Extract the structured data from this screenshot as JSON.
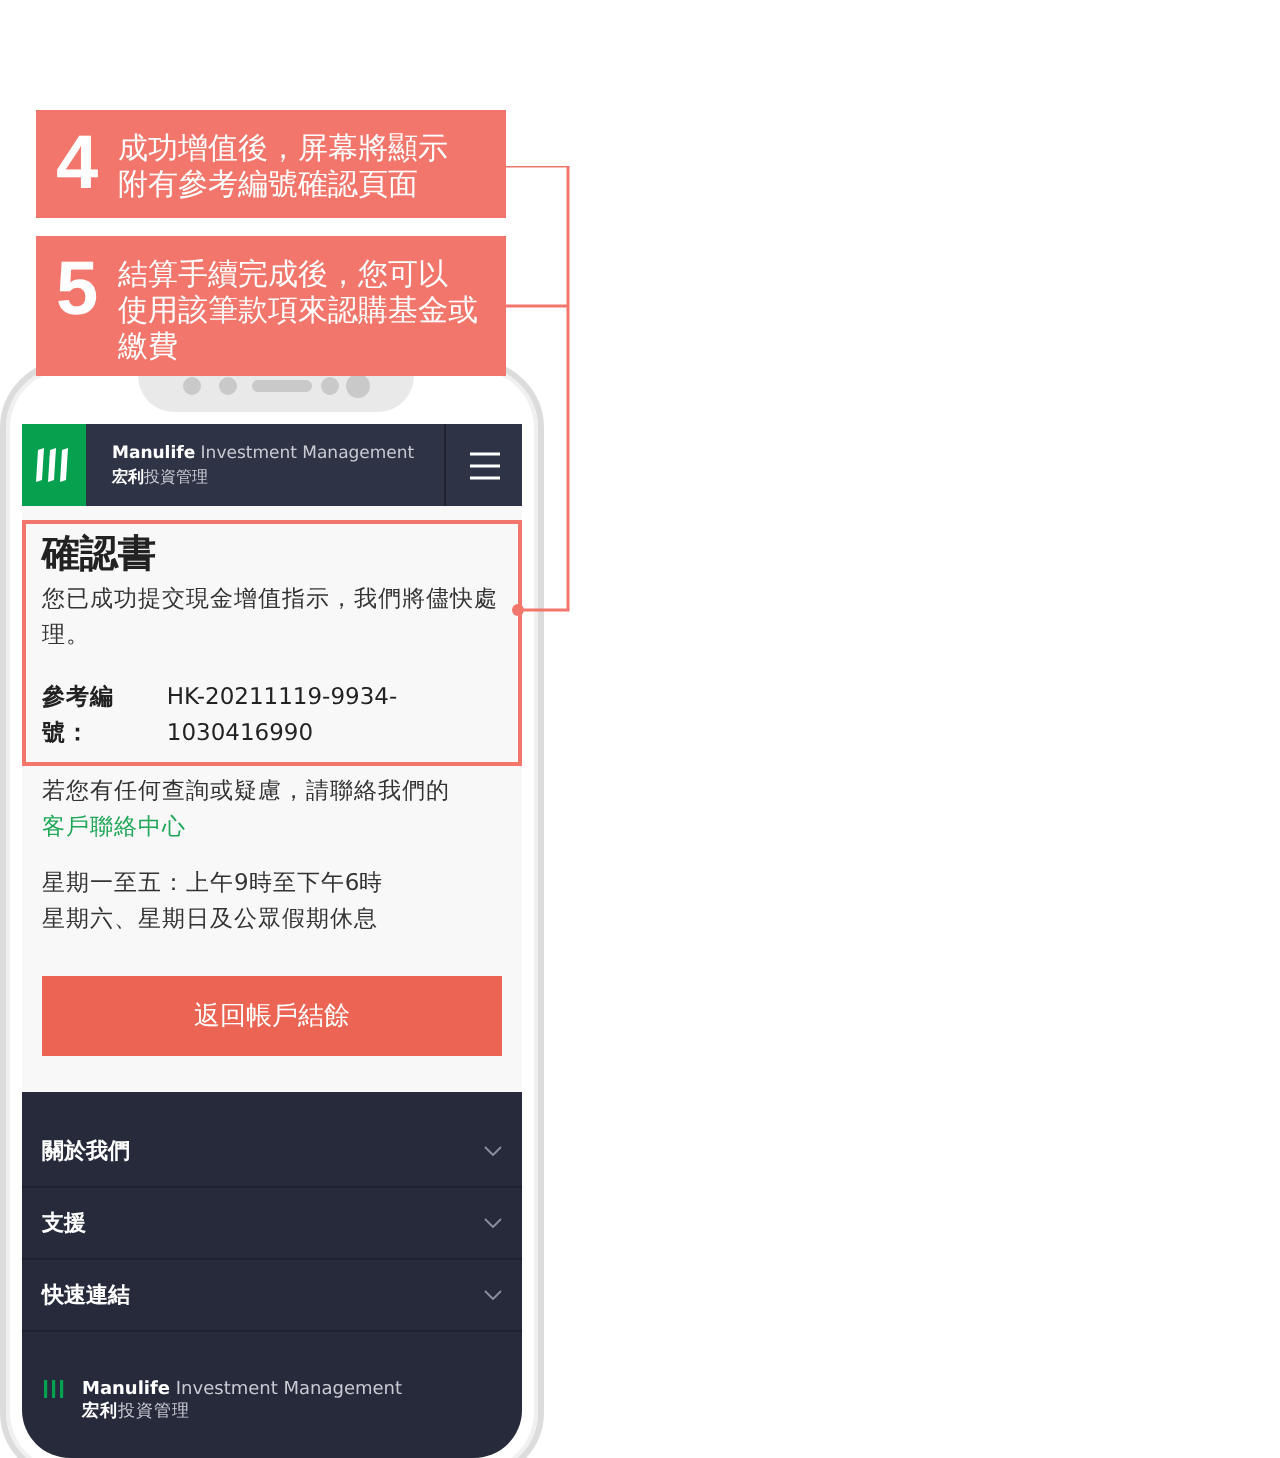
{
  "callouts": [
    {
      "number": "4",
      "lines": [
        "成功增值後，屏幕將顯示",
        "附有參考編號確認頁面"
      ]
    },
    {
      "number": "5",
      "lines": [
        "結算手續完成後，您可以",
        "使用該筆款項來認購基金或",
        "繳費"
      ]
    }
  ],
  "header": {
    "brand_line_1": "**Manulife** Investment Management",
    "brand_line_2": "**宏利**投資管理"
  },
  "confirmation": {
    "title": "確認書",
    "message": "您已成功提交現金增值指示，我們將儘快處理。",
    "reference_label": "參考編號：",
    "reference_value": "HK-20211119-9934-1030416990"
  },
  "contact": {
    "text": "若您有任何查詢或疑慮，請聯絡我們的",
    "link": "客戶聯絡中心"
  },
  "hours": [
    "星期一至五：上午9時至下午6時",
    "星期六、星期日及公眾假期休息"
  ],
  "primary_button": "返回帳戶結餘",
  "footer": {
    "items": [
      {
        "label": "關於我們",
        "expanded": false
      },
      {
        "label": "支援",
        "expanded": false
      },
      {
        "label": "快速連結",
        "expanded": false
      }
    ],
    "brand_line_1": "**Manulife** Investment Management",
    "brand_line_2": "**宏利**投資管理"
  }
}
